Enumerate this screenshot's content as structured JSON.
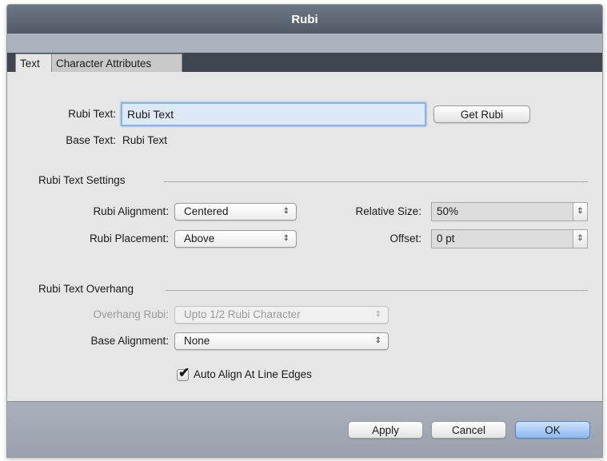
{
  "window": {
    "title": "Rubi"
  },
  "tabs": [
    {
      "label": "Text",
      "selected": true
    },
    {
      "label": "Character Attributes",
      "selected": false
    }
  ],
  "rubi_text": {
    "label": "Rubi Text:",
    "value": "Rubi Text",
    "button": "Get Rubi"
  },
  "base_text": {
    "label": "Base Text:",
    "value": "Rubi Text"
  },
  "settings": {
    "heading": "Rubi Text Settings",
    "alignment": {
      "label": "Rubi Alignment:",
      "value": "Centered"
    },
    "placement": {
      "label": "Rubi Placement:",
      "value": "Above"
    },
    "relative_size": {
      "label": "Relative Size:",
      "value": "50%"
    },
    "offset": {
      "label": "Offset:",
      "value": "0 pt"
    }
  },
  "overhang": {
    "heading": "Rubi Text Overhang",
    "overhang_rubi": {
      "label": "Overhang Rubi:",
      "value": "Upto 1/2 Rubi Character",
      "disabled": true
    },
    "base_alignment": {
      "label": "Base Alignment:",
      "value": "None"
    },
    "auto_align": {
      "label": "Auto Align At Line Edges",
      "checked": true
    }
  },
  "buttons": {
    "apply": "Apply",
    "cancel": "Cancel",
    "ok": "OK"
  },
  "icons": {
    "popup_arrows": "⇕",
    "checkmark": "✔"
  },
  "colors": {
    "accent": "#8ab5e8",
    "titlebar": "#5b6470",
    "tab_strip": "#3f4650"
  }
}
